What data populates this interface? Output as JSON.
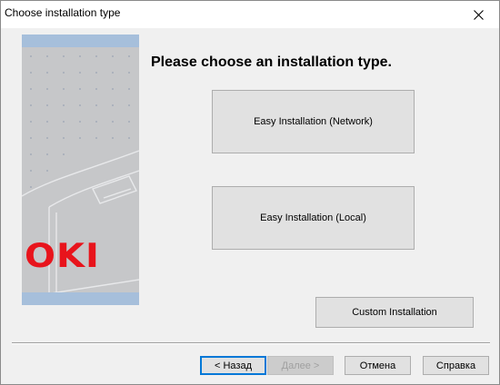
{
  "window": {
    "title": "Choose installation type"
  },
  "heading": "Please choose an installation type.",
  "options": {
    "network": "Easy Installation (Network)",
    "local": "Easy Installation (Local)",
    "custom": "Custom Installation"
  },
  "banner": {
    "logo": "OKI"
  },
  "footer": {
    "back": "< Назад",
    "next": "Далее >",
    "cancel": "Отмена",
    "help": "Справка"
  },
  "colors": {
    "logo_red": "#e8141c",
    "banner_blue": "#a6bfdb",
    "focus_blue": "#0078d7"
  }
}
